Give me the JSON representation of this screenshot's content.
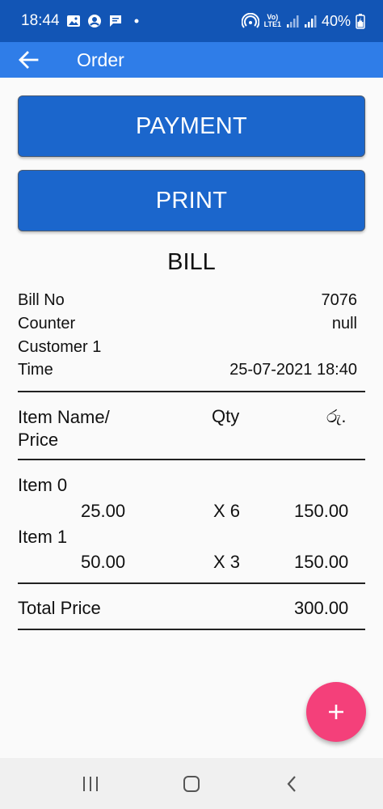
{
  "status_bar": {
    "time": "18:44",
    "battery": "40%",
    "network_label_top": "Vo)",
    "network_label_bottom": "LTE1"
  },
  "app_bar": {
    "title": "Order",
    "back_icon": "arrow-left-icon"
  },
  "buttons": {
    "payment": "PAYMENT",
    "print": "PRINT"
  },
  "bill": {
    "title": "BILL",
    "info": [
      {
        "label": "Bill No",
        "value": "7076"
      },
      {
        "label": "Counter",
        "value": "null"
      },
      {
        "label": "Customer 1",
        "value": ""
      },
      {
        "label": "Time",
        "value": "25-07-2021 18:40"
      }
    ],
    "headers": {
      "item_line1": "Item Name/",
      "item_line2": "Price",
      "qty": "Qty",
      "currency": "රු."
    },
    "items": [
      {
        "name": "Item 0",
        "price": "25.00",
        "qty": "X 6",
        "total": "150.00"
      },
      {
        "name": "Item 1",
        "price": "50.00",
        "qty": "X 3",
        "total": "150.00"
      }
    ],
    "total_label": "Total Price",
    "total_value": "300.00"
  },
  "fab": {
    "icon": "plus-icon"
  },
  "nav_bar": {
    "recents_icon": "recents-icon",
    "home_icon": "home-icon",
    "back_icon": "back-chevron-icon"
  },
  "colors": {
    "status_bar": "#1255b5",
    "app_bar": "#2f7de8",
    "button": "#1b66cc",
    "fab": "#f4407a"
  }
}
